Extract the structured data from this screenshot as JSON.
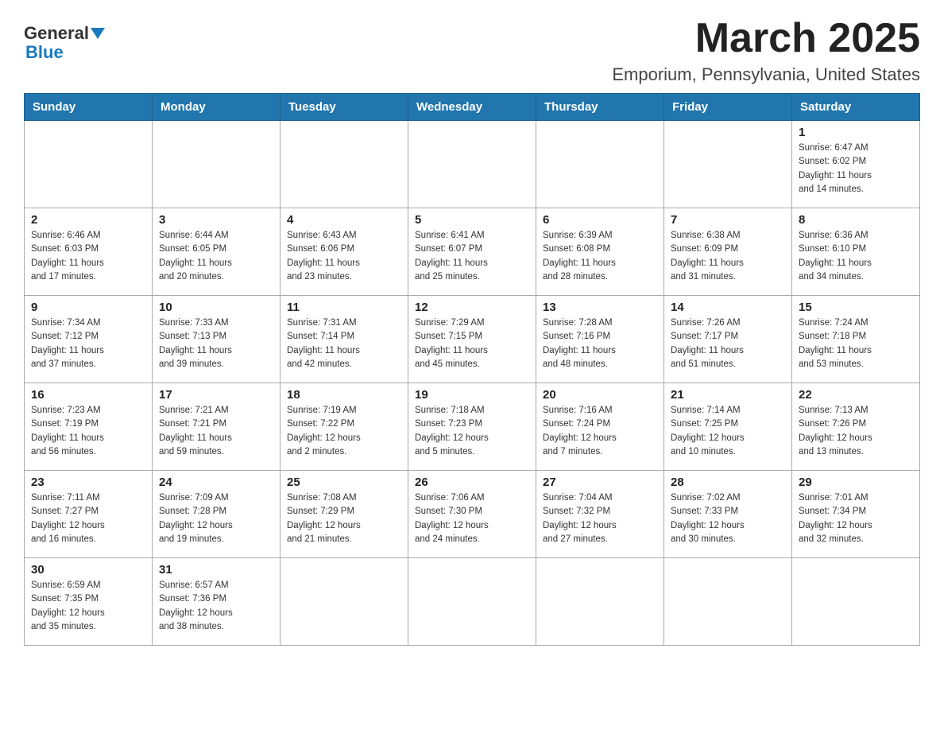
{
  "header": {
    "logo_text1": "General",
    "logo_text2": "Blue",
    "month_title": "March 2025",
    "location": "Emporium, Pennsylvania, United States"
  },
  "days_of_week": [
    "Sunday",
    "Monday",
    "Tuesday",
    "Wednesday",
    "Thursday",
    "Friday",
    "Saturday"
  ],
  "weeks": [
    [
      {
        "day": "",
        "info": ""
      },
      {
        "day": "",
        "info": ""
      },
      {
        "day": "",
        "info": ""
      },
      {
        "day": "",
        "info": ""
      },
      {
        "day": "",
        "info": ""
      },
      {
        "day": "",
        "info": ""
      },
      {
        "day": "1",
        "info": "Sunrise: 6:47 AM\nSunset: 6:02 PM\nDaylight: 11 hours\nand 14 minutes."
      }
    ],
    [
      {
        "day": "2",
        "info": "Sunrise: 6:46 AM\nSunset: 6:03 PM\nDaylight: 11 hours\nand 17 minutes."
      },
      {
        "day": "3",
        "info": "Sunrise: 6:44 AM\nSunset: 6:05 PM\nDaylight: 11 hours\nand 20 minutes."
      },
      {
        "day": "4",
        "info": "Sunrise: 6:43 AM\nSunset: 6:06 PM\nDaylight: 11 hours\nand 23 minutes."
      },
      {
        "day": "5",
        "info": "Sunrise: 6:41 AM\nSunset: 6:07 PM\nDaylight: 11 hours\nand 25 minutes."
      },
      {
        "day": "6",
        "info": "Sunrise: 6:39 AM\nSunset: 6:08 PM\nDaylight: 11 hours\nand 28 minutes."
      },
      {
        "day": "7",
        "info": "Sunrise: 6:38 AM\nSunset: 6:09 PM\nDaylight: 11 hours\nand 31 minutes."
      },
      {
        "day": "8",
        "info": "Sunrise: 6:36 AM\nSunset: 6:10 PM\nDaylight: 11 hours\nand 34 minutes."
      }
    ],
    [
      {
        "day": "9",
        "info": "Sunrise: 7:34 AM\nSunset: 7:12 PM\nDaylight: 11 hours\nand 37 minutes."
      },
      {
        "day": "10",
        "info": "Sunrise: 7:33 AM\nSunset: 7:13 PM\nDaylight: 11 hours\nand 39 minutes."
      },
      {
        "day": "11",
        "info": "Sunrise: 7:31 AM\nSunset: 7:14 PM\nDaylight: 11 hours\nand 42 minutes."
      },
      {
        "day": "12",
        "info": "Sunrise: 7:29 AM\nSunset: 7:15 PM\nDaylight: 11 hours\nand 45 minutes."
      },
      {
        "day": "13",
        "info": "Sunrise: 7:28 AM\nSunset: 7:16 PM\nDaylight: 11 hours\nand 48 minutes."
      },
      {
        "day": "14",
        "info": "Sunrise: 7:26 AM\nSunset: 7:17 PM\nDaylight: 11 hours\nand 51 minutes."
      },
      {
        "day": "15",
        "info": "Sunrise: 7:24 AM\nSunset: 7:18 PM\nDaylight: 11 hours\nand 53 minutes."
      }
    ],
    [
      {
        "day": "16",
        "info": "Sunrise: 7:23 AM\nSunset: 7:19 PM\nDaylight: 11 hours\nand 56 minutes."
      },
      {
        "day": "17",
        "info": "Sunrise: 7:21 AM\nSunset: 7:21 PM\nDaylight: 11 hours\nand 59 minutes."
      },
      {
        "day": "18",
        "info": "Sunrise: 7:19 AM\nSunset: 7:22 PM\nDaylight: 12 hours\nand 2 minutes."
      },
      {
        "day": "19",
        "info": "Sunrise: 7:18 AM\nSunset: 7:23 PM\nDaylight: 12 hours\nand 5 minutes."
      },
      {
        "day": "20",
        "info": "Sunrise: 7:16 AM\nSunset: 7:24 PM\nDaylight: 12 hours\nand 7 minutes."
      },
      {
        "day": "21",
        "info": "Sunrise: 7:14 AM\nSunset: 7:25 PM\nDaylight: 12 hours\nand 10 minutes."
      },
      {
        "day": "22",
        "info": "Sunrise: 7:13 AM\nSunset: 7:26 PM\nDaylight: 12 hours\nand 13 minutes."
      }
    ],
    [
      {
        "day": "23",
        "info": "Sunrise: 7:11 AM\nSunset: 7:27 PM\nDaylight: 12 hours\nand 16 minutes."
      },
      {
        "day": "24",
        "info": "Sunrise: 7:09 AM\nSunset: 7:28 PM\nDaylight: 12 hours\nand 19 minutes."
      },
      {
        "day": "25",
        "info": "Sunrise: 7:08 AM\nSunset: 7:29 PM\nDaylight: 12 hours\nand 21 minutes."
      },
      {
        "day": "26",
        "info": "Sunrise: 7:06 AM\nSunset: 7:30 PM\nDaylight: 12 hours\nand 24 minutes."
      },
      {
        "day": "27",
        "info": "Sunrise: 7:04 AM\nSunset: 7:32 PM\nDaylight: 12 hours\nand 27 minutes."
      },
      {
        "day": "28",
        "info": "Sunrise: 7:02 AM\nSunset: 7:33 PM\nDaylight: 12 hours\nand 30 minutes."
      },
      {
        "day": "29",
        "info": "Sunrise: 7:01 AM\nSunset: 7:34 PM\nDaylight: 12 hours\nand 32 minutes."
      }
    ],
    [
      {
        "day": "30",
        "info": "Sunrise: 6:59 AM\nSunset: 7:35 PM\nDaylight: 12 hours\nand 35 minutes."
      },
      {
        "day": "31",
        "info": "Sunrise: 6:57 AM\nSunset: 7:36 PM\nDaylight: 12 hours\nand 38 minutes."
      },
      {
        "day": "",
        "info": ""
      },
      {
        "day": "",
        "info": ""
      },
      {
        "day": "",
        "info": ""
      },
      {
        "day": "",
        "info": ""
      },
      {
        "day": "",
        "info": ""
      }
    ]
  ]
}
